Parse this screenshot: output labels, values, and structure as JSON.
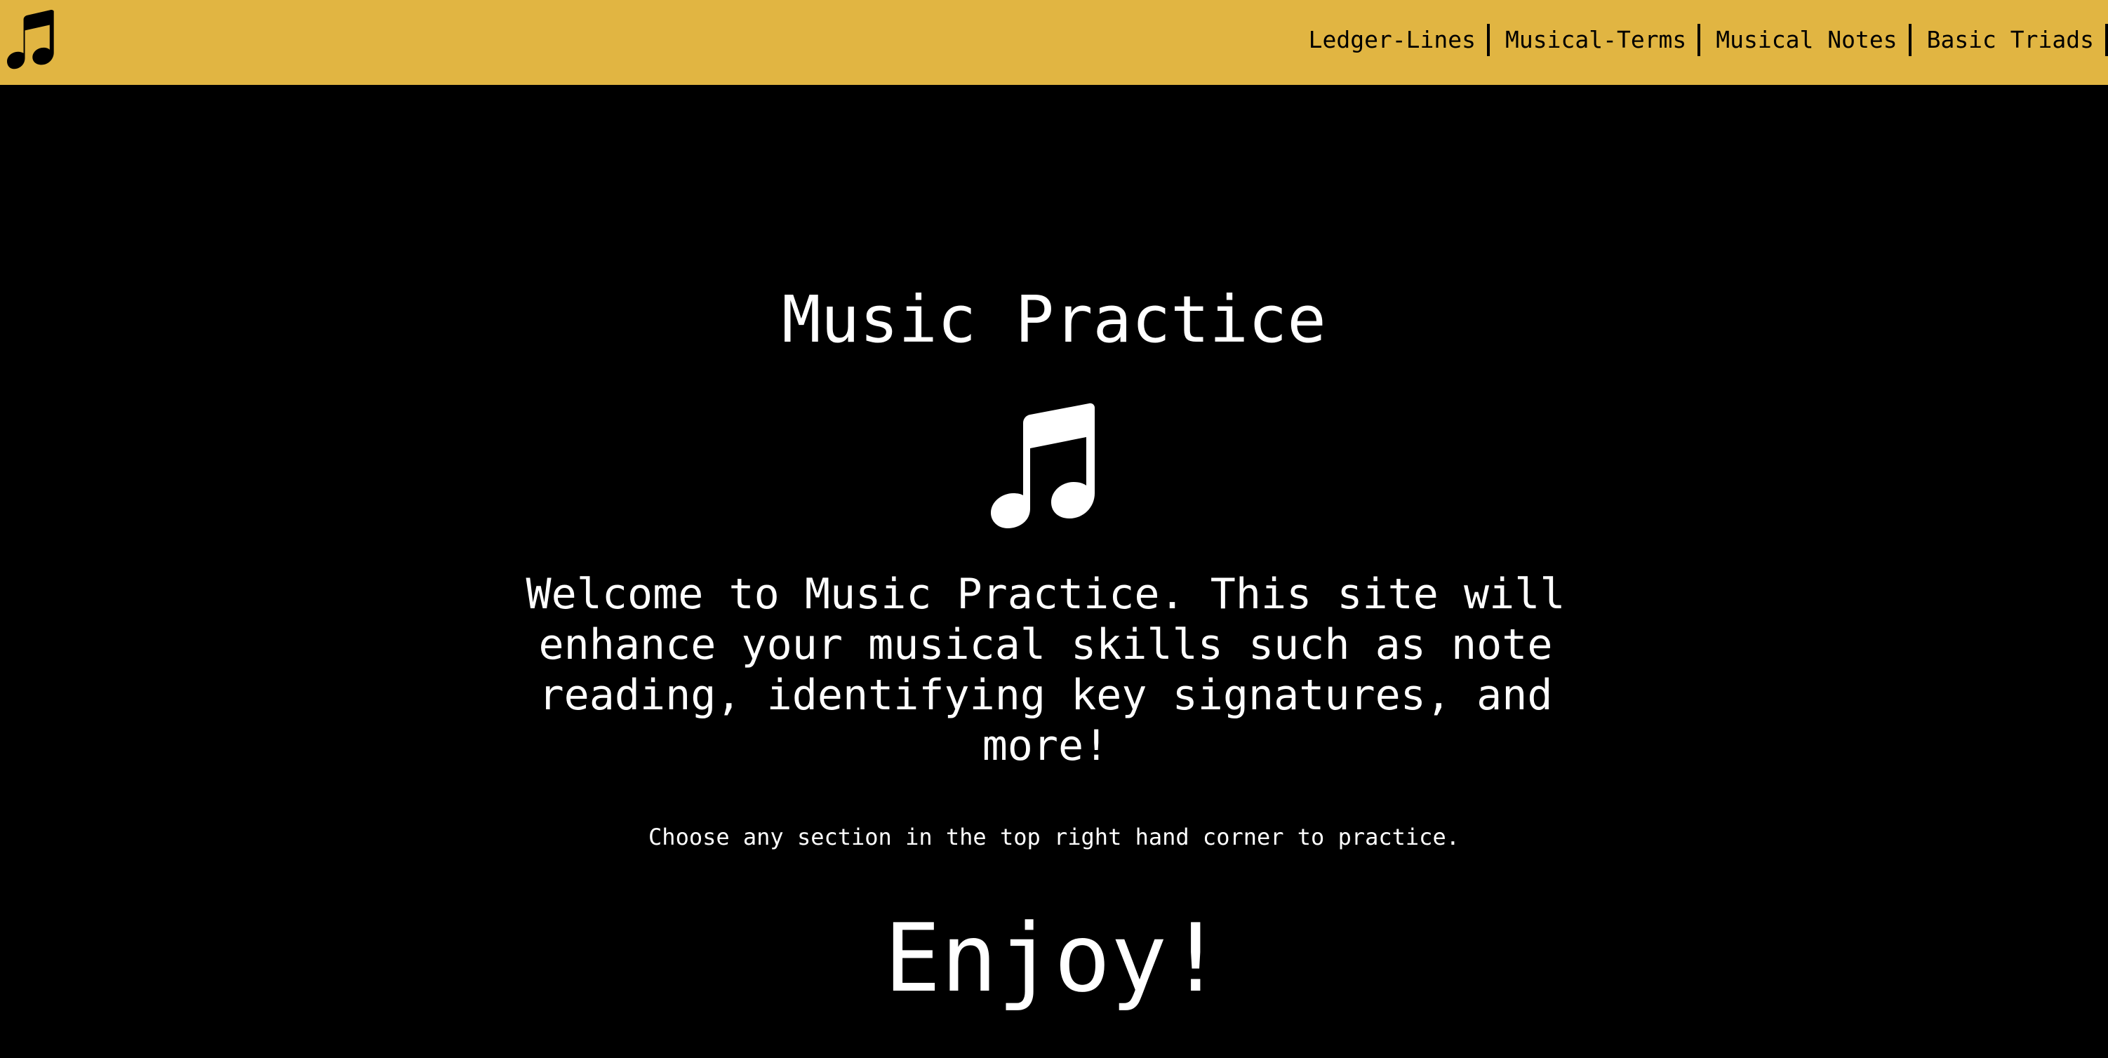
{
  "header": {
    "logo_icon": "music-note-icon",
    "background_color": "#e1b542",
    "nav": [
      {
        "label": "Ledger-Lines"
      },
      {
        "label": "Musical-Terms"
      },
      {
        "label": "Musical Notes"
      },
      {
        "label": "Basic Triads"
      }
    ]
  },
  "main": {
    "title": "Music Practice",
    "hero_icon": "music-note-icon",
    "welcome_text": "Welcome to Music Practice. This site will enhance your musical skills such as note reading, identifying key signatures, and more!",
    "instruction_text": "Choose any section in the top right hand corner to practice.",
    "closing_text": "Enjoy!"
  }
}
